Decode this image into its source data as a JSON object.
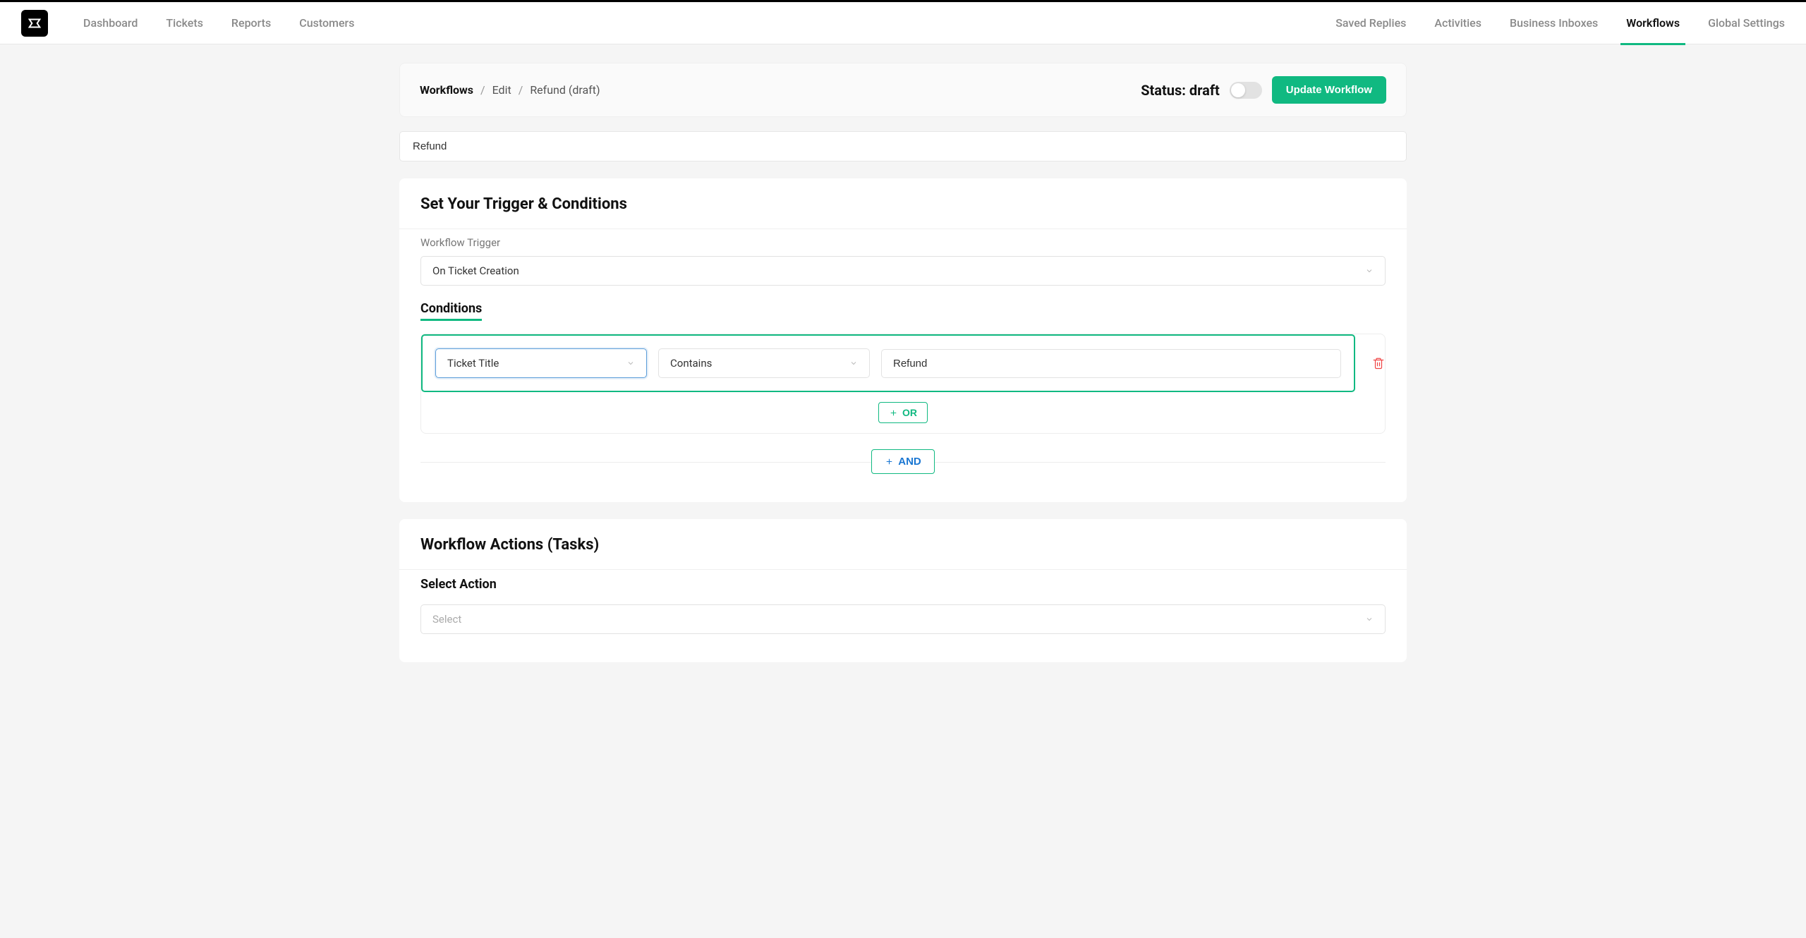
{
  "nav": {
    "left": [
      "Dashboard",
      "Tickets",
      "Reports",
      "Customers"
    ],
    "right": [
      "Saved Replies",
      "Activities",
      "Business Inboxes",
      "Workflows",
      "Global Settings"
    ],
    "active": "Workflows"
  },
  "breadcrumb": {
    "root": "Workflows",
    "edit": "Edit",
    "item": "Refund (draft)"
  },
  "status": {
    "label": "Status:",
    "value": "draft"
  },
  "buttons": {
    "update": "Update Workflow",
    "or": "OR",
    "and": "AND"
  },
  "workflow_name": "Refund",
  "trigger_section": {
    "title": "Set Your Trigger & Conditions",
    "trigger_label": "Workflow Trigger",
    "trigger_value": "On Ticket Creation",
    "conditions_label": "Conditions",
    "condition": {
      "field": "Ticket Title",
      "operator": "Contains",
      "value": "Refund"
    }
  },
  "actions_section": {
    "title": "Workflow Actions (Tasks)",
    "select_label": "Select Action",
    "select_placeholder": "Select"
  }
}
